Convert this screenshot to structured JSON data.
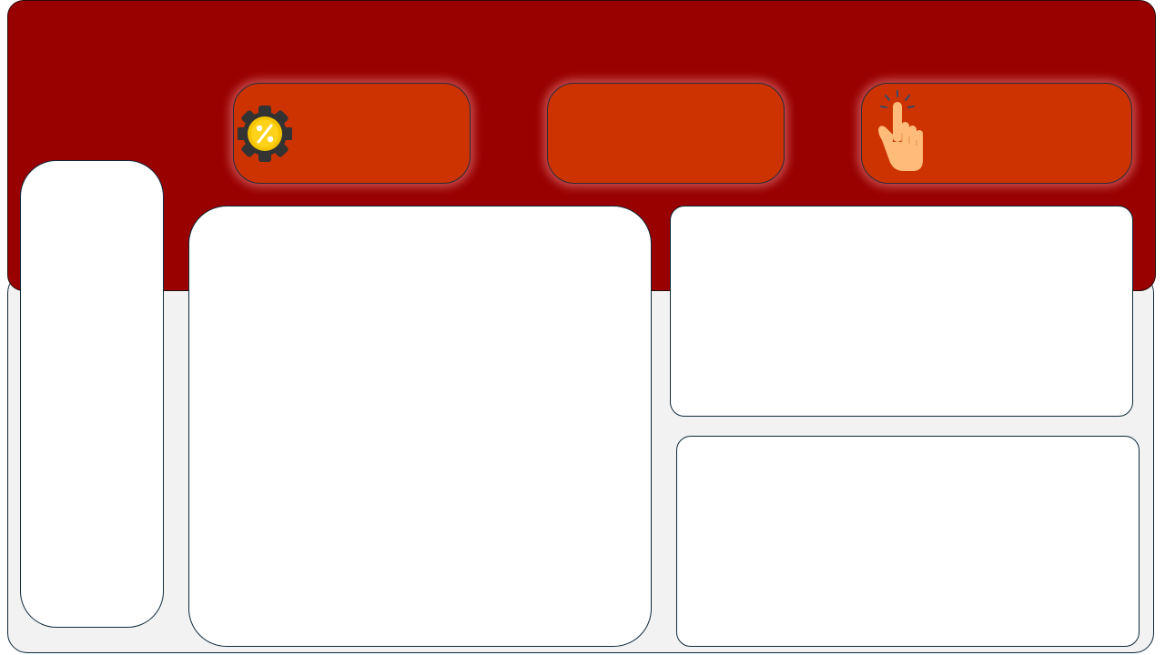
{
  "header": {
    "background_color": "#990000",
    "buttons": [
      {
        "label": "",
        "icon": "discount-badge-icon"
      },
      {
        "label": "",
        "icon": ""
      },
      {
        "label": "",
        "icon": "pointing-hand-icon"
      }
    ],
    "button_color": "#cc3300"
  },
  "layout": {
    "sidebar_panel": {
      "content": ""
    },
    "main_panel": {
      "content": ""
    },
    "top_right_panel": {
      "content": ""
    },
    "bottom_right_panel": {
      "content": ""
    }
  },
  "colors": {
    "page_background": "#f2f2f2",
    "card_background": "#ffffff",
    "border": "#102a3a",
    "badge_gold": "#f5c400",
    "badge_dark": "#333333",
    "hand_skin": "#ffbb7a"
  }
}
